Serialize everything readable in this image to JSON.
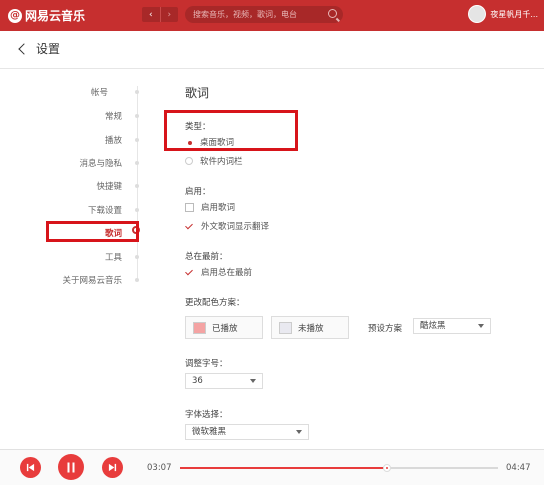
{
  "app": {
    "logo_text": "网易云音乐",
    "search_placeholder": "搜索音乐，视频，歌词，电台",
    "username": "夜星帆月千..."
  },
  "header": {
    "title": "设置"
  },
  "sidebar": {
    "items": [
      {
        "label": "帐号"
      },
      {
        "label": "常规"
      },
      {
        "label": "播放"
      },
      {
        "label": "消息与隐私"
      },
      {
        "label": "快捷键"
      },
      {
        "label": "下载设置"
      },
      {
        "label": "歌词",
        "active": true
      },
      {
        "label": "工具"
      },
      {
        "label": "关于网易云音乐"
      }
    ]
  },
  "lyrics": {
    "section_title": "歌词",
    "type_label": "类型：",
    "type_options": [
      "桌面歌词",
      "软件内词栏"
    ],
    "type_selected": "桌面歌词",
    "enable_label": "启用：",
    "enable_options": [
      {
        "label": "启用歌词",
        "checked": false
      },
      {
        "label": "外文歌词显示翻译",
        "checked": true
      }
    ],
    "top_label": "总在最前：",
    "top_option": {
      "label": "启用总在最前",
      "checked": true
    },
    "color_label": "更改配色方案：",
    "color_played": "已播放",
    "color_unplayed": "未播放",
    "preset_label": "预设方案",
    "preset_value": "酷炫黑",
    "fontsize_label": "调整字号：",
    "fontsize_value": "36",
    "font_label": "字体选择：",
    "font_value": "微软雅黑"
  },
  "player": {
    "current_time": "03:07",
    "total_time": "04:47",
    "progress": 0.65
  },
  "colors": {
    "brand": "#c62f2f",
    "played_swatch": "#f4a3a3",
    "unplayed_swatch": "#e9e9f0",
    "highlight_box": "#d7141a"
  }
}
